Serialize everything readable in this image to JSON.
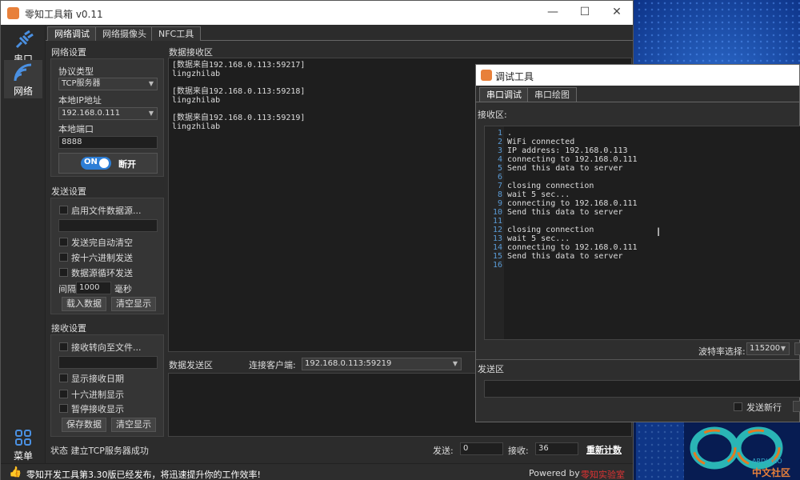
{
  "desktop": {
    "logo_text": "ARDUINO",
    "logo_cn": "中文社区"
  },
  "main": {
    "title": "零知工具箱 v0.11",
    "sidebar": [
      {
        "label": "串口"
      },
      {
        "label": "网络"
      },
      {
        "label": "菜单"
      }
    ],
    "tabs": [
      {
        "label": "网络调试"
      },
      {
        "label": "网络摄像头"
      },
      {
        "label": "NFC工具"
      }
    ],
    "net_settings": {
      "title": "网络设置",
      "protocol_label": "协议类型",
      "protocol": "TCP服务器",
      "local_ip_label": "本地IP地址",
      "local_ip": "192.168.0.111",
      "port_label": "本地端口",
      "port": "8888",
      "toggle_on": "ON",
      "disconnect": "断开"
    },
    "send_settings": {
      "title": "发送设置",
      "file_source": "启用文件数据源...",
      "auto_clear": "发送完自动清空",
      "hex_send": "按十六进制发送",
      "loop_send": "数据源循环发送",
      "interval_label": "间隔",
      "interval": "1000",
      "interval_unit": "毫秒",
      "load_btn": "载入数据",
      "clear_btn": "清空显示"
    },
    "recv_settings": {
      "title": "接收设置",
      "redirect": "接收转向至文件...",
      "show_date": "显示接收日期",
      "hex_show": "十六进制显示",
      "pause": "暂停接收显示",
      "save_btn": "保存数据",
      "clear_btn": "清空显示"
    },
    "recv_area": {
      "title": "数据接收区",
      "content": "[数据来自192.168.0.113:59217]\nlingzhilab\n\n[数据来自192.168.0.113:59218]\nlingzhilab\n\n[数据来自192.168.0.113:59219]\nlingzhilab"
    },
    "send_area": {
      "title": "数据发送区",
      "client_label": "连接客户端:",
      "client": "192.168.0.113:59219"
    },
    "status": {
      "text": "状态 建立TCP服务器成功",
      "send_label": "发送:",
      "send_count": "0",
      "recv_label": "接收:",
      "recv_count": "36",
      "reset": "重新计数"
    },
    "footer": {
      "notice": "零知开发工具第3.30版已经发布，将迅速提升你的工作效率!",
      "powered": "Powered by",
      "powered_brand": "零知实验室"
    }
  },
  "debug": {
    "title": "调试工具",
    "tabs": [
      {
        "label": "串口调试"
      },
      {
        "label": "串口绘图"
      }
    ],
    "recv_label": "接收区:",
    "lines": [
      ".",
      "WiFi connected",
      "IP address: 192.168.0.113",
      "connecting to 192.168.0.111",
      "Send this data to server",
      "",
      "closing connection",
      "wait 5 sec...",
      "connecting to 192.168.0.111",
      "Send this data to server",
      "",
      "closing connection",
      "wait 5 sec...",
      "connecting to 192.168.0.111",
      "Send this data to server",
      ""
    ],
    "baud_label": "波特率选择:",
    "baud": "115200",
    "send_label": "发送区",
    "newline_label": "发送新行"
  }
}
